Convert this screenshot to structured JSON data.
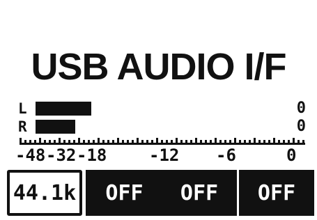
{
  "screen": {
    "title": "USB AUDIO I/F"
  },
  "meter": {
    "channels": [
      {
        "label": "L",
        "level": 0.21,
        "peak": "0"
      },
      {
        "label": "R",
        "level": 0.15,
        "peak": "0"
      }
    ],
    "scale": [
      "-48",
      "-32",
      "-18",
      "-12",
      "-6",
      "0"
    ]
  },
  "buttons": [
    {
      "label": "44.1k",
      "style": "outline"
    },
    {
      "label": "OFF",
      "style": "filled"
    },
    {
      "label": "OFF",
      "style": "filled"
    },
    {
      "label": "OFF",
      "style": "filled"
    }
  ],
  "colors": {
    "foreground": "#111111",
    "background": "#ffffff"
  }
}
